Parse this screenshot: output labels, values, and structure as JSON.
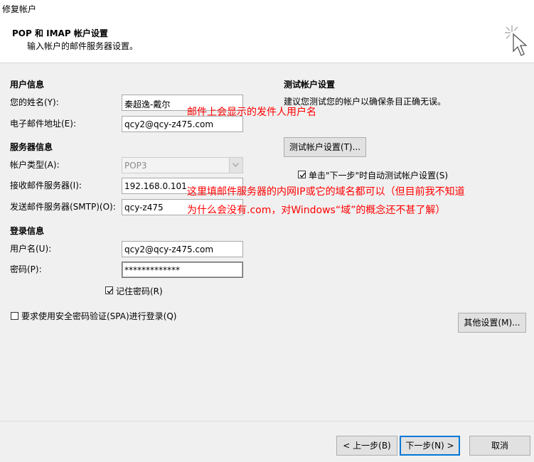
{
  "window": {
    "title": "修复帐户"
  },
  "header": {
    "title": "POP 和 IMAP 帐户设置",
    "subtitle": "输入帐户的邮件服务器设置。",
    "icon": "cursor-sparkle-icon"
  },
  "user_info": {
    "section": "用户信息",
    "name_label": "您的姓名(Y):",
    "name_value": "秦超逸-戴尔",
    "email_label": "电子邮件地址(E):",
    "email_value": "qcy2@qcy-z475.com"
  },
  "server_info": {
    "section": "服务器信息",
    "account_type_label": "帐户类型(A):",
    "account_type_value": "POP3",
    "incoming_label": "接收邮件服务器(I):",
    "incoming_value": "192.168.0.101",
    "outgoing_label": "发送邮件服务器(SMTP)(O):",
    "outgoing_value": "qcy-z475"
  },
  "login_info": {
    "section": "登录信息",
    "username_label": "用户名(U):",
    "username_value": "qcy2@qcy-z475.com",
    "password_label": "密码(P):",
    "password_value": "*************",
    "remember_label": "记住密码(R)",
    "remember_checked": true
  },
  "spa": {
    "label": "要求使用安全密码验证(SPA)进行登录(Q)",
    "checked": false
  },
  "test": {
    "section": "测试帐户设置",
    "desc": "建议您测试您的帐户以确保条目正确无误。",
    "button": "测试帐户设置(T)...",
    "auto_label": "单击\"下一步\"时自动测试帐户设置(S)",
    "auto_checked": true
  },
  "more_settings_button": "其他设置(M)...",
  "annotations": {
    "note1": "邮件上会显示的发件人用户名",
    "note2_line1": "这里填邮件服务器的内网IP或它的域名都可以（但目前我不知道",
    "note2_line2": "为什么会没有.com，对Windows“域”的概念还不甚了解）",
    "color": "#ff0000"
  },
  "footer": {
    "back_button": "< 上一步(B)",
    "next_button": "下一步(N) >",
    "cancel_button": "取消"
  }
}
